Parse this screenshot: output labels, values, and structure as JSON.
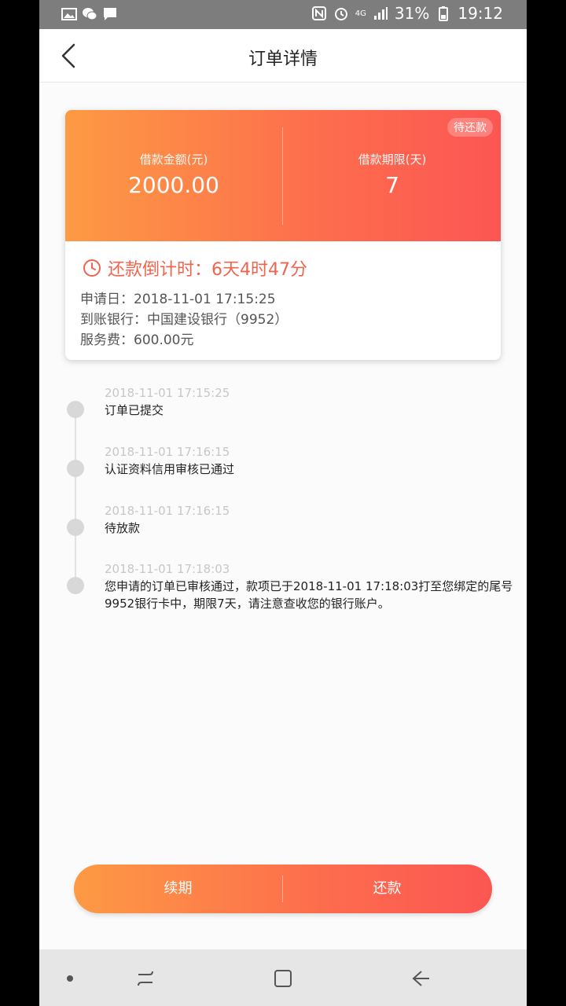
{
  "status_bar": {
    "left_icons": [
      "image-icon",
      "wechat-icon",
      "message-icon"
    ],
    "right_icons": [
      "nfc-icon",
      "alarm-icon",
      "signal-icon",
      "battery-icon"
    ],
    "network": "4G",
    "battery": "31%",
    "time": "19:12"
  },
  "header": {
    "title": "订单详情"
  },
  "card": {
    "badge": "待还款",
    "amount_label": "借款金额(元)",
    "amount": "2000.00",
    "term_label": "借款期限(天)",
    "term": "7",
    "countdown": "还款倒计时：6天4时47分",
    "apply_date": "申请日：2018-11-01 17:15:25",
    "bank": "到账银行：中国建设银行（9952）",
    "fee": "服务费：600.00元"
  },
  "timeline": [
    {
      "time": "2018-11-01 17:15:25",
      "text": "订单已提交"
    },
    {
      "time": "2018-11-01 17:16:15",
      "text": "认证资料信用审核已通过"
    },
    {
      "time": "2018-11-01 17:16:15",
      "text": "待放款"
    },
    {
      "time": "2018-11-01 17:18:03",
      "text": "您申请的订单已审核通过，款项已于2018-11-01 17:18:03打至您绑定的尾号9952银行卡中，期限7天，请注意查收您的银行账户。"
    }
  ],
  "actions": {
    "renew": "续期",
    "repay": "还款"
  },
  "colors": {
    "gradient_start": "#fd9a44",
    "gradient_end": "#fc5653",
    "countdown": "#f0644e"
  }
}
